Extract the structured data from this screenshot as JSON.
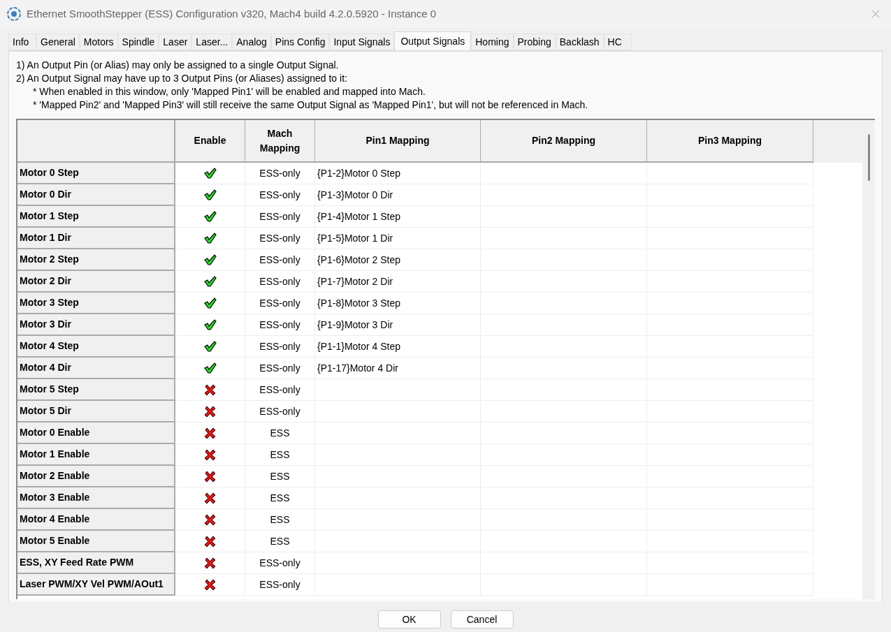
{
  "window": {
    "title": "Ethernet SmoothStepper (ESS) Configuration v320, Mach4 build 4.2.0.5920 - Instance 0"
  },
  "tabs": [
    {
      "label": "Info",
      "selected": false
    },
    {
      "label": "General",
      "selected": false
    },
    {
      "label": "Motors",
      "selected": false
    },
    {
      "label": "Spindle",
      "selected": false
    },
    {
      "label": "Laser",
      "selected": false
    },
    {
      "label": "Laser...",
      "selected": false
    },
    {
      "label": "Analog",
      "selected": false
    },
    {
      "label": "Pins Config",
      "selected": false
    },
    {
      "label": "Input Signals",
      "selected": false
    },
    {
      "label": "Output Signals",
      "selected": true
    },
    {
      "label": "Homing",
      "selected": false
    },
    {
      "label": "Probing",
      "selected": false
    },
    {
      "label": "Backlash",
      "selected": false
    },
    {
      "label": "HC",
      "selected": false
    }
  ],
  "notes": [
    "1) An Output Pin (or Alias) may only be assigned to a single Output Signal.",
    "2) An Output Signal may have up to 3 Output Pins (or Aliases) assigned to it:",
    "* When enabled in this window, only 'Mapped Pin1' will be enabled and mapped into Mach.",
    "* 'Mapped Pin2' and 'Mapped Pin3' will still receive the same Output Signal as 'Mapped Pin1', but will not be referenced in Mach."
  ],
  "table": {
    "columns": [
      "Enable",
      "Mach Mapping",
      "Pin1 Mapping",
      "Pin2 Mapping",
      "Pin3 Mapping"
    ],
    "rows": [
      {
        "name": "Motor 0 Step",
        "enabled": true,
        "mach": "ESS-only",
        "pin1": "{P1-2}Motor 0 Step"
      },
      {
        "name": "Motor 0 Dir",
        "enabled": true,
        "mach": "ESS-only",
        "pin1": "{P1-3}Motor 0 Dir"
      },
      {
        "name": "Motor 1 Step",
        "enabled": true,
        "mach": "ESS-only",
        "pin1": "{P1-4}Motor 1 Step"
      },
      {
        "name": "Motor 1 Dir",
        "enabled": true,
        "mach": "ESS-only",
        "pin1": "{P1-5}Motor 1 Dir"
      },
      {
        "name": "Motor 2 Step",
        "enabled": true,
        "mach": "ESS-only",
        "pin1": "{P1-6}Motor 2 Step"
      },
      {
        "name": "Motor 2 Dir",
        "enabled": true,
        "mach": "ESS-only",
        "pin1": "{P1-7}Motor 2 Dir"
      },
      {
        "name": "Motor 3 Step",
        "enabled": true,
        "mach": "ESS-only",
        "pin1": "{P1-8}Motor 3 Step"
      },
      {
        "name": "Motor 3 Dir",
        "enabled": true,
        "mach": "ESS-only",
        "pin1": "{P1-9}Motor 3 Dir"
      },
      {
        "name": "Motor 4 Step",
        "enabled": true,
        "mach": "ESS-only",
        "pin1": "{P1-1}Motor 4 Step"
      },
      {
        "name": "Motor 4 Dir",
        "enabled": true,
        "mach": "ESS-only",
        "pin1": "{P1-17}Motor 4 Dir"
      },
      {
        "name": "Motor 5 Step",
        "enabled": false,
        "mach": "ESS-only"
      },
      {
        "name": "Motor 5 Dir",
        "enabled": false,
        "mach": "ESS-only"
      },
      {
        "name": "Motor 0 Enable",
        "enabled": false,
        "mach": "ESS"
      },
      {
        "name": "Motor 1 Enable",
        "enabled": false,
        "mach": "ESS"
      },
      {
        "name": "Motor 2 Enable",
        "enabled": false,
        "mach": "ESS"
      },
      {
        "name": "Motor 3 Enable",
        "enabled": false,
        "mach": "ESS"
      },
      {
        "name": "Motor 4 Enable",
        "enabled": false,
        "mach": "ESS"
      },
      {
        "name": "Motor 5 Enable",
        "enabled": false,
        "mach": "ESS"
      },
      {
        "name": "ESS, XY Feed Rate PWM",
        "enabled": false,
        "mach": "ESS-only"
      },
      {
        "name": "Laser PWM/XY Vel PWM/AOut1",
        "enabled": false,
        "mach": "ESS-only"
      }
    ]
  },
  "buttons": [
    "OK",
    "Cancel"
  ]
}
